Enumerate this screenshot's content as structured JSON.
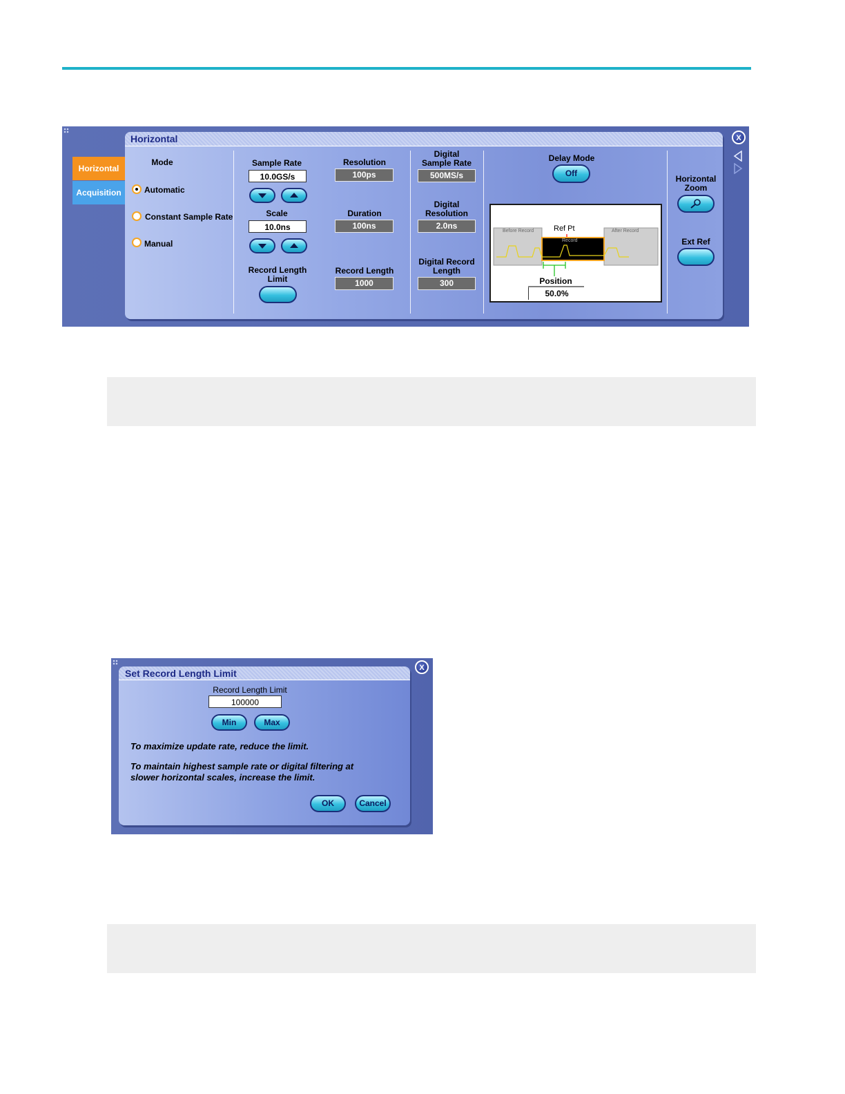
{
  "horizontal_panel": {
    "title": "Horizontal",
    "tabs": [
      {
        "label": "Horizontal",
        "active": true
      },
      {
        "label": "Acquisition",
        "active": false
      }
    ],
    "mode": {
      "label": "Mode",
      "options": [
        "Automatic",
        "Constant Sample Rate",
        "Manual"
      ],
      "selected": "Automatic"
    },
    "sample_rate": {
      "label": "Sample Rate",
      "value": "10.0GS/s"
    },
    "scale": {
      "label": "Scale",
      "value": "10.0ns"
    },
    "record_length_limit": {
      "label_line1": "Record Length",
      "label_line2": "Limit"
    },
    "resolution": {
      "label": "Resolution",
      "value": "100ps"
    },
    "duration": {
      "label": "Duration",
      "value": "100ns"
    },
    "record_length": {
      "label": "Record Length",
      "value": "1000"
    },
    "digital_sample_rate": {
      "label_line1": "Digital",
      "label_line2": "Sample Rate",
      "value": "500MS/s"
    },
    "digital_resolution": {
      "label_line1": "Digital",
      "label_line2": "Resolution",
      "value": "2.0ns"
    },
    "digital_record_length": {
      "label_line1": "Digital Record",
      "label_line2": "Length",
      "value": "300"
    },
    "delay_mode": {
      "label": "Delay Mode",
      "button": "Off"
    },
    "diagram": {
      "before_record": "Before Record",
      "after_record": "After Record",
      "ref_pt": "Ref Pt",
      "record": "Record",
      "position_label": "Position",
      "position_value": "50.0%"
    },
    "horizontal_zoom": {
      "label_line1": "Horizontal",
      "label_line2": "Zoom"
    },
    "ext_ref": {
      "label": "Ext Ref"
    },
    "close_label": "X"
  },
  "record_length_dialog": {
    "title": "Set Record Length Limit",
    "field_label": "Record Length Limit",
    "field_value": "100000",
    "min_label": "Min",
    "max_label": "Max",
    "message1": "To maximize update rate, reduce the limit.",
    "message2_line1": "To maintain highest sample rate or digital filtering at",
    "message2_line2": "slower horizontal scales, increase the limit.",
    "ok_label": "OK",
    "cancel_label": "Cancel",
    "close_label": "X"
  },
  "colors": {
    "rule": "#1eb2c9",
    "active_tab": "#f5921e",
    "inactive_tab": "#4aa3ea",
    "panel_bg": "#5164ad"
  }
}
